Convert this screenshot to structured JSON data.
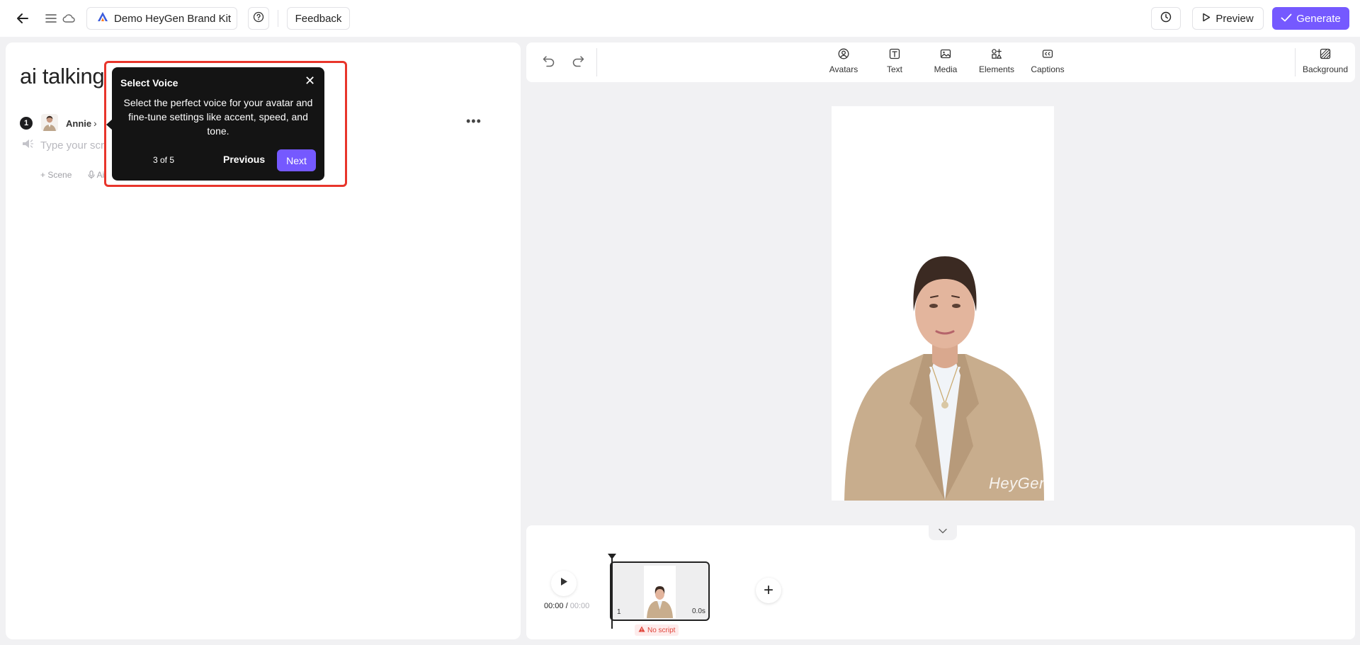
{
  "topbar": {
    "brand_kit": "Demo HeyGen Brand Kit",
    "feedback": "Feedback",
    "preview": "Preview",
    "generate": "Generate"
  },
  "editor": {
    "title": "ai talking",
    "scene_number": "1",
    "avatar_name": "Annie",
    "script_placeholder": "Type your scri",
    "add_scene": "+ Scene",
    "add_audio": "Ai"
  },
  "tour": {
    "title": "Select Voice",
    "body": "Select the perfect voice for your avatar and fine-tune settings like accent, speed, and tone.",
    "step": "3 of 5",
    "previous": "Previous",
    "next": "Next"
  },
  "toolbar": {
    "avatars": "Avatars",
    "text": "Text",
    "media": "Media",
    "elements": "Elements",
    "captions": "Captions",
    "background": "Background"
  },
  "canvas": {
    "watermark": "HeyGen"
  },
  "timeline": {
    "current_time": "00:00",
    "total_time": "00:00",
    "clip_number": "1",
    "clip_duration": "0.0s",
    "warning": "No script"
  },
  "colors": {
    "accent": "#7559ff",
    "tooltip_bg": "#141414",
    "highlight": "#e8352b",
    "warning": "#e0443a"
  },
  "icons": [
    "back-arrow-icon",
    "menu-icon",
    "cloud-icon",
    "brand-kit-icon",
    "help-icon",
    "history-icon",
    "play-icon",
    "check-icon",
    "undo-icon",
    "redo-icon",
    "avatar-icon",
    "text-icon",
    "image-icon",
    "elements-icon",
    "cc-icon",
    "background-icon",
    "chevron-down-icon",
    "plus-icon",
    "warning-icon"
  ]
}
